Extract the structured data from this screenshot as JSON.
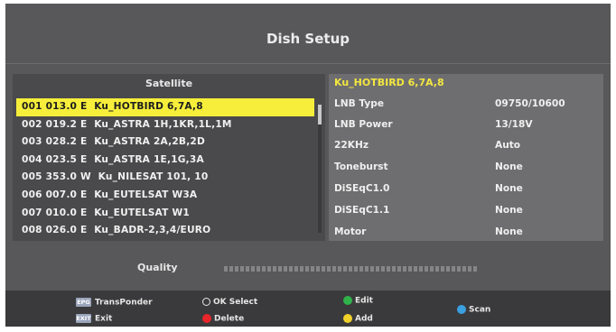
{
  "title": "Dish Setup",
  "satellite_panel": {
    "header": "Satellite",
    "items": [
      {
        "label": "001 013.0 E  Ku_HOTBIRD 6,7A,8",
        "selected": true
      },
      {
        "label": "002 019.2 E  Ku_ASTRA 1H,1KR,1L,1M",
        "selected": false
      },
      {
        "label": "003 028.2 E  Ku_ASTRA 2A,2B,2D",
        "selected": false
      },
      {
        "label": "004 023.5 E  Ku_ASTRA 1E,1G,3A",
        "selected": false
      },
      {
        "label": "005 353.0 W  Ku_NILESAT 101, 10",
        "selected": false
      },
      {
        "label": "006 007.0 E  Ku_EUTELSAT W3A",
        "selected": false
      },
      {
        "label": "007 010.0 E  Ku_EUTELSAT W1",
        "selected": false
      },
      {
        "label": "008 026.0 E  Ku_BADR-2,3,4/EURO",
        "selected": false
      }
    ]
  },
  "settings_panel": {
    "title": "Ku_HOTBIRD 6,7A,8",
    "rows": [
      {
        "label": "LNB Type",
        "value": "09750/10600"
      },
      {
        "label": "LNB Power",
        "value": "13/18V"
      },
      {
        "label": "22KHz",
        "value": "Auto"
      },
      {
        "label": "Toneburst",
        "value": "None"
      },
      {
        "label": "DiSEqC1.0",
        "value": "None"
      },
      {
        "label": "DiSEqC1.1",
        "value": "None"
      },
      {
        "label": "Motor",
        "value": "None"
      }
    ]
  },
  "quality": {
    "label": "Quality"
  },
  "footer": {
    "epg_key": "EPG",
    "exit_key": "EXIT",
    "transponder": "TransPonder",
    "exit": "Exit",
    "ok_select": "OK Select",
    "delete": "Delete",
    "edit": "Edit",
    "add": "Add",
    "scan": "Scan"
  },
  "colors": {
    "selected_row": "#f6ee3a",
    "settings_title": "#f2e640",
    "red_button": "#e8262a",
    "green_button": "#2fb24a",
    "yellow_button": "#f0d12a",
    "blue_button": "#3aa0e0"
  }
}
